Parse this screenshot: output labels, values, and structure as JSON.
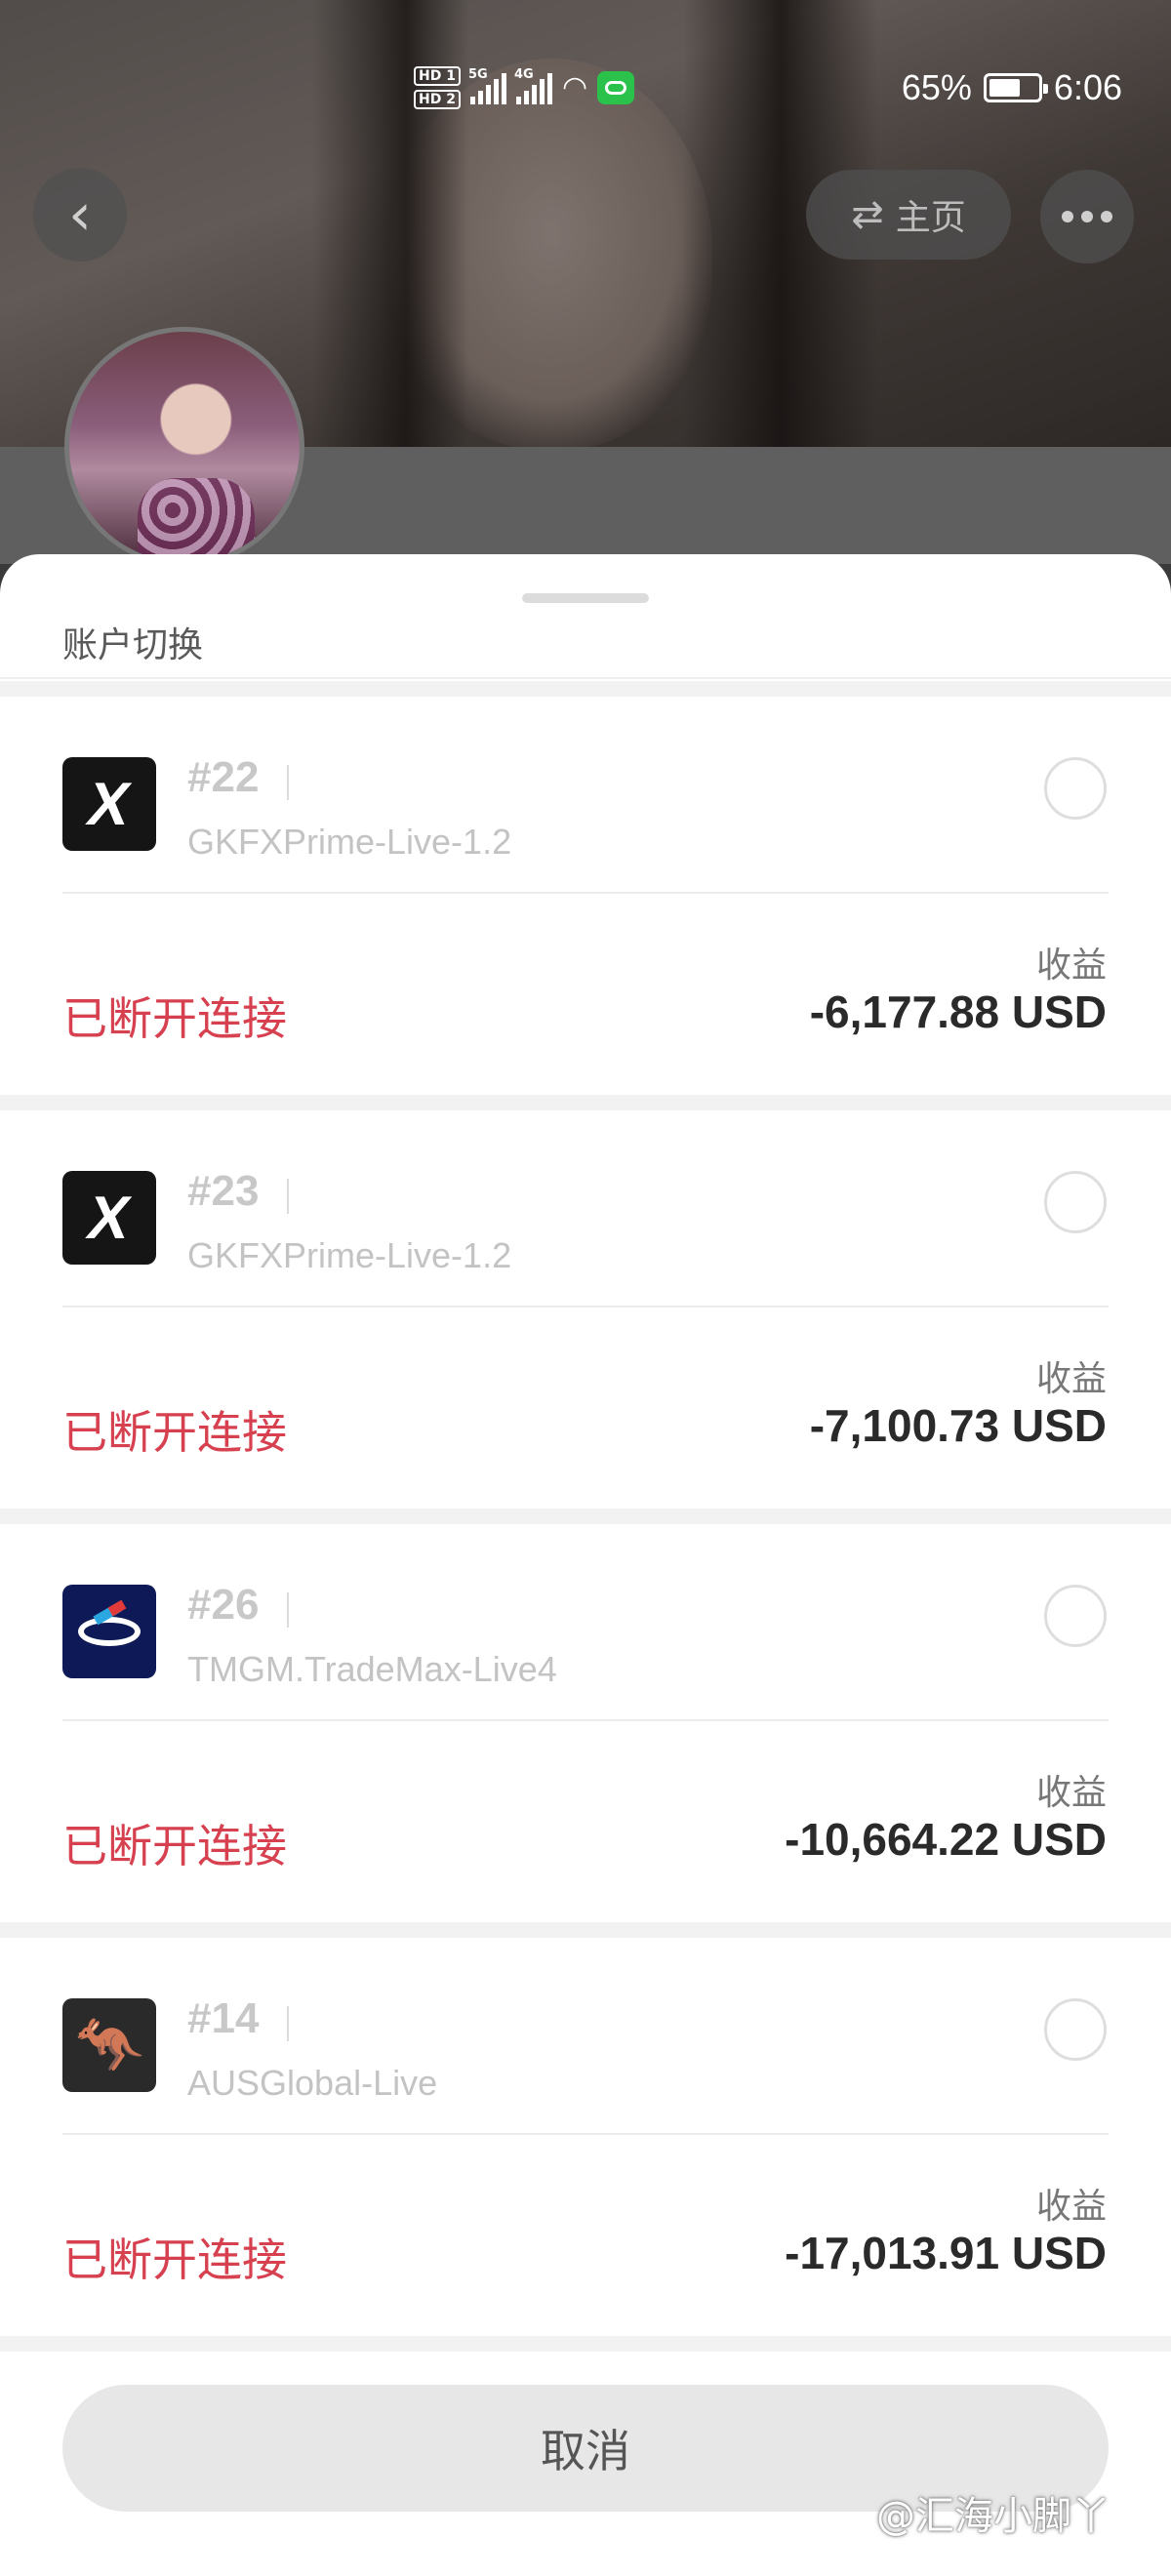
{
  "status_bar": {
    "hd1": "HD 1",
    "hd2": "HD 2",
    "net_5g": "5G",
    "net_4g": "4G",
    "battery_text": "65%",
    "battery_level": 0.65,
    "time": "6:06",
    "icons": [
      "signal-icon",
      "wifi-icon",
      "chat-notification-icon",
      "battery-icon"
    ]
  },
  "header": {
    "back_icon": "chevron-left-icon",
    "home_label": "主页",
    "home_icon": "swap-icon",
    "more_icon": "more-dots-icon"
  },
  "sheet": {
    "title": "账户切换",
    "accounts": [
      {
        "number": "#22",
        "server": "GKFXPrime-Live-1.2",
        "logo": "gkfx-x-logo",
        "profit_label": "收益",
        "status": "已断开连接",
        "profit": "-6,177.88 USD"
      },
      {
        "number": "#23",
        "server": "GKFXPrime-Live-1.2",
        "logo": "gkfx-x-logo",
        "profit_label": "收益",
        "status": "已断开连接",
        "profit": "-7,100.73 USD"
      },
      {
        "number": "#26",
        "server": "TMGM.TradeMax-Live4",
        "logo": "tmgm-logo",
        "profit_label": "收益",
        "status": "已断开连接",
        "profit": "-10,664.22 USD"
      },
      {
        "number": "#14",
        "server": "AUSGlobal-Live",
        "logo": "kangaroo-logo",
        "profit_label": "收益",
        "status": "已断开连接",
        "profit": "-17,013.91 USD"
      }
    ],
    "cancel_label": "取消"
  },
  "colors": {
    "status_disconnected": "#d6404f",
    "profit_text": "#2a2a2a",
    "muted_text": "#c3c3c3"
  },
  "watermark": "@汇海小脚丫"
}
